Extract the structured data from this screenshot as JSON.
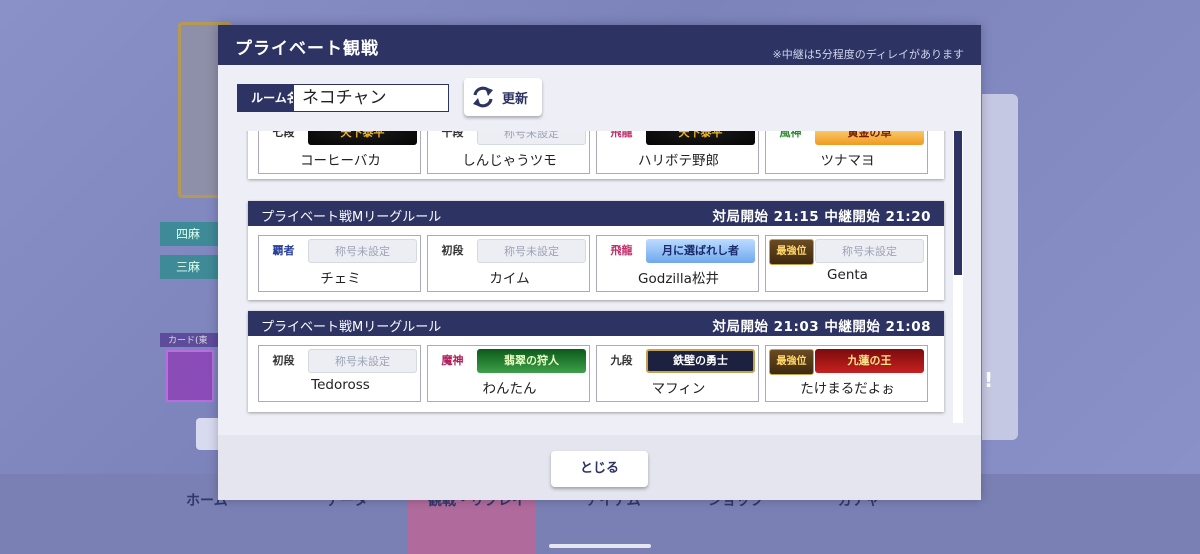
{
  "background": {
    "modes": [
      "四麻",
      "三麻"
    ],
    "card_label": "カード(東",
    "nav": [
      "ホーム",
      "データ",
      "観戦・リプレイ",
      "アイテム",
      "ショップ",
      "ガチャ"
    ]
  },
  "dialog": {
    "title": "プライベート観戦",
    "note": "※中継は5分程度のディレイがあります",
    "room_label": "ルーム名",
    "room_value": "ネコチャン",
    "refresh_label": "更新",
    "close_label": "とじる"
  },
  "rooms": [
    {
      "rule": "",
      "time": "",
      "players": [
        {
          "rank": "七段",
          "title": "天下泰平",
          "name": "コーヒーバカ"
        },
        {
          "rank": "十段",
          "title": "称号未設定",
          "name": "しんじゃうツモ"
        },
        {
          "rank": "飛龍",
          "title": "天下泰平",
          "name": "ハリボテ野郎"
        },
        {
          "rank": "風神",
          "title": "黄金の卓",
          "name": "ツナマヨ"
        }
      ]
    },
    {
      "rule": "プライベート戦Mリーグルール",
      "time": "対局開始 21:15 中継開始 21:20",
      "players": [
        {
          "rank": "覇者",
          "title": "称号未設定",
          "name": "チェミ"
        },
        {
          "rank": "初段",
          "title": "称号未設定",
          "name": "カイム"
        },
        {
          "rank": "飛龍",
          "title": "月に選ばれし者",
          "name": "Godzilla松井"
        },
        {
          "rank": "最強位",
          "title": "称号未設定",
          "name": "Genta"
        }
      ]
    },
    {
      "rule": "プライベート戦Mリーグルール",
      "time": "対局開始 21:03 中継開始 21:08",
      "players": [
        {
          "rank": "初段",
          "title": "称号未設定",
          "name": "Tedoross"
        },
        {
          "rank": "魔神",
          "title": "翡翠の狩人",
          "name": "わんたん"
        },
        {
          "rank": "九段",
          "title": "鉄壁の勇士",
          "name": "マフィン"
        },
        {
          "rank": "最強位",
          "title": "九蓮の王",
          "name": "たけまるだよぉ"
        }
      ]
    }
  ],
  "colors": {
    "accent": "#2d3363",
    "panel": "#eeeff6"
  }
}
